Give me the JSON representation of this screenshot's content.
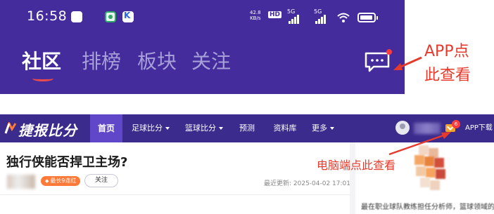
{
  "app": {
    "status_bar": {
      "time": "16:58",
      "net_speed_value": "42.8",
      "net_speed_unit": "KB/s",
      "hd_label": "HD",
      "signal1_label": "5G",
      "signal2_label": "5G",
      "wifi_icon": "wifi-icon",
      "battery_icon": "battery-icon"
    },
    "tabs": [
      {
        "label": "社区",
        "active": true
      },
      {
        "label": "排榜",
        "active": false
      },
      {
        "label": "板块",
        "active": false
      },
      {
        "label": "关注",
        "active": false
      }
    ],
    "message_icon": "chat-bubble-icon",
    "annotation": {
      "line1": "APP点",
      "line2": "此查看"
    }
  },
  "pc": {
    "logo_text": "捷报比分",
    "nav_items": [
      {
        "label": "首页",
        "active": true,
        "dropdown": false
      },
      {
        "label": "足球比分",
        "active": false,
        "dropdown": true
      },
      {
        "label": "篮球比分",
        "active": false,
        "dropdown": true
      },
      {
        "label": "预测",
        "active": false,
        "dropdown": false
      },
      {
        "label": "资料库",
        "active": false,
        "dropdown": false
      },
      {
        "label": "更多",
        "active": false,
        "dropdown": true
      }
    ],
    "mail_badge": "6",
    "app_download": "APP下载",
    "article": {
      "title": "独行侠能否捍卫主场?",
      "level_badge": "最长9连红",
      "follow_label": "关注",
      "update_time": "最近更新: 2025-04-02 17:01"
    },
    "side_text": "最在职业球队教练担任分析师，篮球领域的专",
    "annotation": "电脑端点此查看"
  },
  "colors": {
    "app_bg": "#452c9c",
    "pc_nav_bg": "#3b2b8c",
    "pc_nav_active": "#6046c8",
    "annotation_red": "#e63a2c",
    "badge_orange": "#ff7a38"
  }
}
